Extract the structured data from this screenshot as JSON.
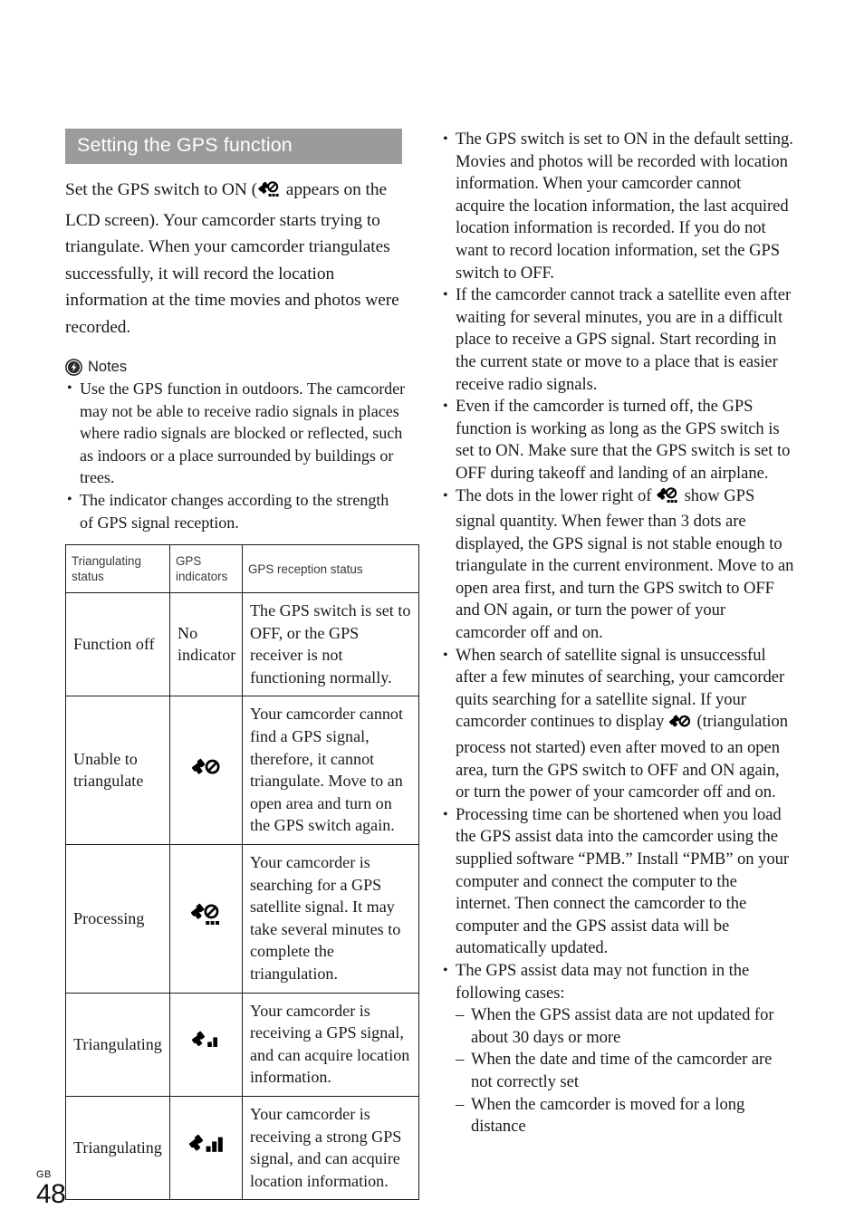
{
  "page": {
    "folio_region": "GB",
    "folio_number": "48"
  },
  "section": {
    "title": "Setting the GPS function",
    "title_bar_color": "#9b9b9b",
    "title_text_color": "#ffffff"
  },
  "intro": {
    "before_icon": "Set the GPS switch to ON (",
    "icon": "gps-searching-icon",
    "after_icon": " appears on the LCD screen). Your camcorder starts trying to triangulate. When your camcorder triangulates successfully, it will record the location information at the time movies and photos were recorded."
  },
  "notes": {
    "icon": "notes-badge-icon",
    "label": "Notes",
    "items": [
      "Use the GPS function in outdoors. The camcorder may not be able to receive radio signals in places where radio signals are blocked or reflected, such as indoors or a place surrounded by buildings or trees.",
      "The indicator changes according to the strength of GPS signal reception."
    ]
  },
  "table": {
    "headers": {
      "status": "Triangulating status",
      "indicators": "GPS indicators",
      "reception": "GPS reception status"
    },
    "rows": [
      {
        "status": "Function off",
        "indicator_text": "No indicator",
        "indicator_icon": null,
        "description": "The GPS switch is set to OFF, or the GPS receiver is not functioning normally."
      },
      {
        "status": "Unable to triangulate",
        "indicator_text": null,
        "indicator_icon": "gps-no-signal-icon",
        "description": "Your camcorder cannot find a GPS signal, therefore, it cannot triangulate. Move to an open area and turn on the GPS switch again."
      },
      {
        "status": "Processing",
        "indicator_text": null,
        "indicator_icon": "gps-searching-icon",
        "description": "Your camcorder is searching for a GPS satellite signal. It may take several minutes to complete the triangulation."
      },
      {
        "status": "Triangulating",
        "indicator_text": null,
        "indicator_icon": "gps-signal-2bars-icon",
        "description": "Your camcorder is receiving a GPS signal, and can acquire location information."
      },
      {
        "status": "Triangulating",
        "indicator_text": null,
        "indicator_icon": "gps-signal-3bars-icon",
        "description": "Your camcorder is receiving a strong GPS signal, and can acquire location information."
      }
    ]
  },
  "right_column": {
    "bullets": [
      {
        "text": "The GPS switch is set to ON in the default setting. Movies and photos will be recorded with location information. When your camcorder cannot acquire the location information, the last acquired location information is recorded. If you do not want to record location information, set the GPS switch to OFF."
      },
      {
        "text": "If the camcorder cannot track a satellite even after waiting for several minutes, you are in a difficult place to receive a GPS signal. Start recording in the current state or move to a place that is easier receive radio signals."
      },
      {
        "text": "Even if the camcorder is turned off, the GPS function is working as long as the GPS switch is set to ON. Make sure that the GPS switch is set to OFF during takeoff and landing of an airplane."
      },
      {
        "before_icon": "The dots in the lower right of ",
        "icon": "gps-searching-icon",
        "after_icon": " show GPS signal quantity. When fewer than 3 dots are displayed, the GPS signal is not stable enough to triangulate in the current environment. Move to an open area first, and turn the GPS switch to OFF and ON again, or turn the power of your camcorder off and on."
      },
      {
        "before_icon": "When search of satellite signal is unsuccessful after a few minutes of searching, your camcorder quits searching for a satellite signal. If your camcorder continues to display ",
        "icon": "gps-no-signal-icon",
        "after_icon": " (triangulation process not started) even after moved to an open area, turn the GPS switch to OFF and ON again, or turn the power of your camcorder off and on."
      },
      {
        "text": "Processing time can be shortened when you load the GPS assist data into the camcorder using the supplied software “PMB.” Install “PMB” on your computer and connect the computer to the internet. Then connect the camcorder to the computer and the GPS assist data will be automatically updated."
      }
    ],
    "last_bullet": {
      "text": "The GPS assist data may not function in the following cases:",
      "sub_items": [
        "When the GPS assist data are not updated for about 30 days or more",
        "When the date and time of the camcorder are not correctly set",
        "When the camcorder is moved for a long distance"
      ]
    }
  }
}
